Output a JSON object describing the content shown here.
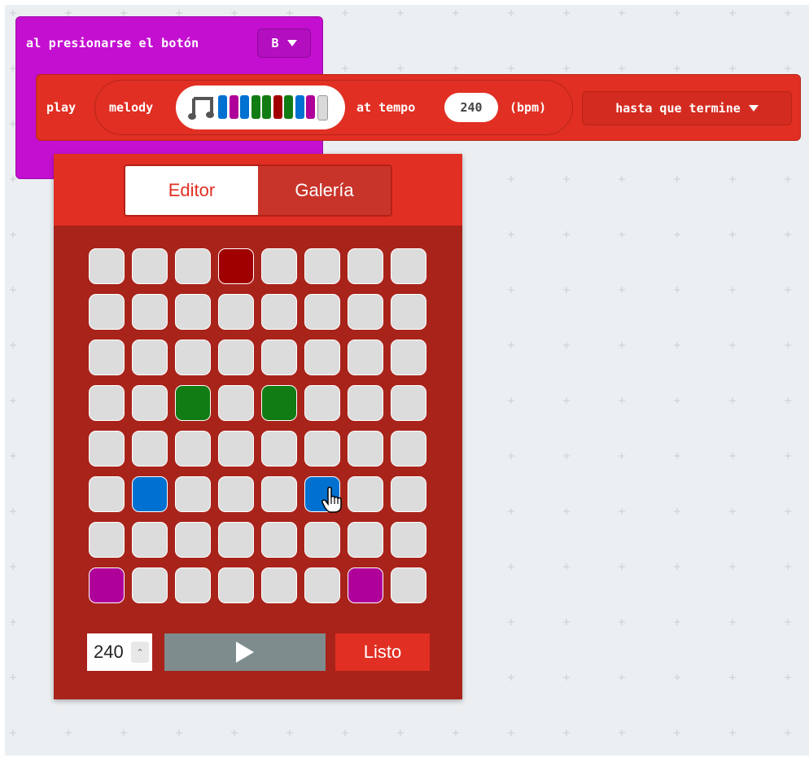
{
  "event_block": {
    "label": "al presionarse el botón",
    "button_value": "B"
  },
  "play_block": {
    "play_label": "play",
    "melody_label": "melody",
    "mini_notes": [
      "#0071d0",
      "#b0009a",
      "#0071d0",
      "#127c14",
      "#127c14",
      "#a10000",
      "#127c14",
      "#0071d0",
      "#b0009a",
      "#d9d9d9"
    ],
    "tempo_label": "at tempo",
    "tempo_value": "240",
    "bpm_label": "(bpm)",
    "mode_value": "hasta que termine"
  },
  "editor": {
    "tabs": [
      {
        "label": "Editor",
        "active": true
      },
      {
        "label": "Galería",
        "active": false
      }
    ],
    "grid": {
      "rows": 8,
      "cols": 8,
      "note_colors": {
        "red": "#a10000",
        "green": "#127c14",
        "blue": "#0071d0",
        "purple": "#b0009a",
        "empty": "#dcdcdc"
      },
      "cells": [
        [
          "empty",
          "empty",
          "empty",
          "red",
          "empty",
          "empty",
          "empty",
          "empty"
        ],
        [
          "empty",
          "empty",
          "empty",
          "empty",
          "empty",
          "empty",
          "empty",
          "empty"
        ],
        [
          "empty",
          "empty",
          "empty",
          "empty",
          "empty",
          "empty",
          "empty",
          "empty"
        ],
        [
          "empty",
          "empty",
          "green",
          "empty",
          "green",
          "empty",
          "empty",
          "empty"
        ],
        [
          "empty",
          "empty",
          "empty",
          "empty",
          "empty",
          "empty",
          "empty",
          "empty"
        ],
        [
          "empty",
          "blue",
          "empty",
          "empty",
          "empty",
          "blue",
          "empty",
          "empty"
        ],
        [
          "empty",
          "empty",
          "empty",
          "empty",
          "empty",
          "empty",
          "empty",
          "empty"
        ],
        [
          "purple",
          "empty",
          "empty",
          "empty",
          "empty",
          "empty",
          "purple",
          "empty"
        ]
      ]
    },
    "tempo_input_value": "240",
    "play_icon": "play-triangle-icon",
    "done_label": "Listo"
  },
  "colors": {
    "event_block": "#c40fd1",
    "music_block": "#e12f23",
    "editor_body": "#a8231a",
    "play_button": "#7e8c8d"
  }
}
